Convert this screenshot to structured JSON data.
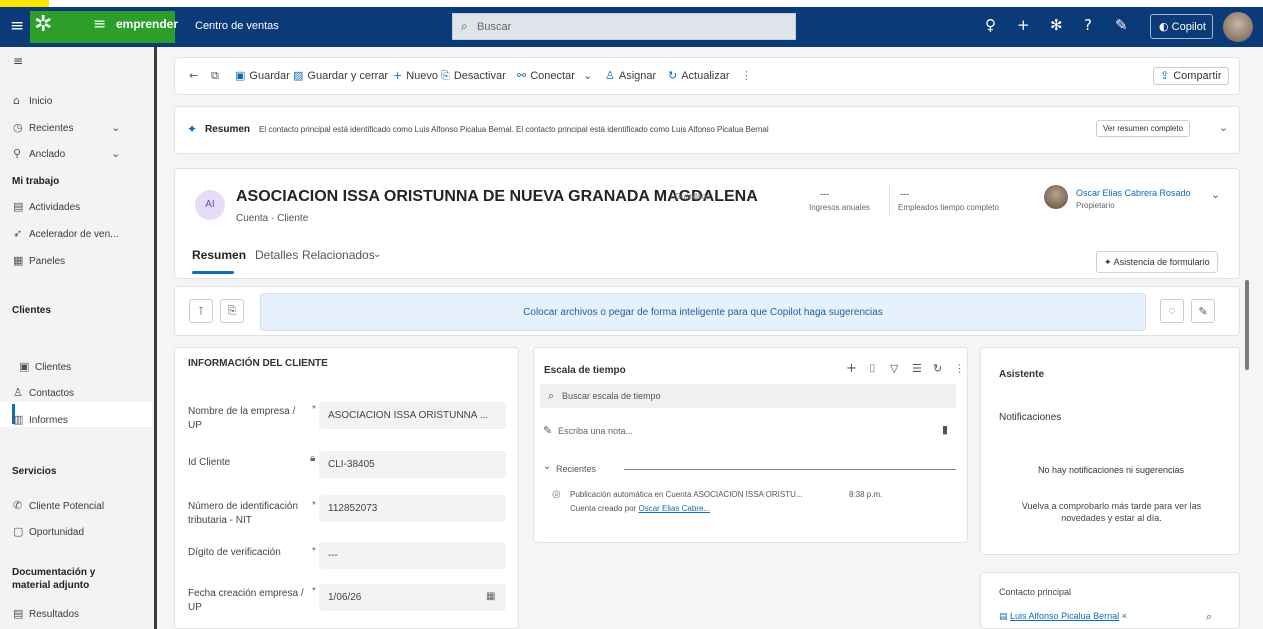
{
  "topbar": {
    "app_name": "Centro de ventas",
    "search_placeholder": "Buscar",
    "logo_word": "emprender",
    "copilot_label": "Copilot"
  },
  "sidebar": {
    "items_top": [
      {
        "label": "Inicio"
      },
      {
        "label": "Recientes"
      },
      {
        "label": "Anclado"
      }
    ],
    "sections": [
      {
        "title": "Mi trabajo",
        "items": [
          "Actividades",
          "Acelerador de ven...",
          "Paneles"
        ]
      },
      {
        "title": "Clientes",
        "items": [
          "Clientes",
          "Contactos",
          "Informes"
        ]
      },
      {
        "title": "Servicios",
        "items": [
          "Cliente Potencial",
          "Oportunidad"
        ]
      },
      {
        "title": "Documentación y material adjunto",
        "items": [
          "Resultados"
        ]
      }
    ]
  },
  "toolbar": {
    "save": "Guardar",
    "save_close": "Guardar y cerrar",
    "new": "Nuevo",
    "deactivate": "Desactivar",
    "connect": "Conectar",
    "assign": "Asignar",
    "refresh": "Actualizar",
    "share": "Compartir"
  },
  "summary": {
    "label": "Resumen",
    "text": "El contacto principal está identificado como Luis Alfonso Picalua Bernal. El contacto principal está identificado como Luis Alfonso Picalua Bernal",
    "view_full": "Ver resumen completo"
  },
  "record": {
    "initials": "AI",
    "name": "ASOCIACION ISSA ORISTUNNA DE NUEVA GRANADA MAGDALENA",
    "saved": "- Guardado",
    "subtitle": "Cuenta · Cliente",
    "stat1_value": "---",
    "stat1_label": "Ingresos anuales",
    "stat2_value": "---",
    "stat2_label": "Empleados tiempo completo",
    "owner_name": "Oscar Elias Cabrera Rosado",
    "owner_role": "Propietario",
    "tabs": [
      "Resumen",
      "Detalles",
      "Relacionados"
    ],
    "form_assist": "Asistencia de formulario"
  },
  "dropzone": {
    "text": "Colocar archivos o pegar de forma inteligente para que Copilot haga sugerencias"
  },
  "client_info": {
    "title": "INFORMACIÓN DEL CLIENTE",
    "fields": [
      {
        "label": "Nombre de la empresa / UP",
        "value": "ASOCIACION ISSA ORISTUNNA ..."
      },
      {
        "label": "Id Cliente",
        "value": "CLI-38405"
      },
      {
        "label": "Número de identificación tributaria - NIT",
        "value": "112852073"
      },
      {
        "label": "Dígito de verificación",
        "value": "---"
      },
      {
        "label": "Fecha creación empresa / UP",
        "value": "1/06/26"
      }
    ]
  },
  "timeline": {
    "title": "Escala de tiempo",
    "search_placeholder": "Buscar escala de tiempo",
    "note_placeholder": "Escriba una nota...",
    "recent_label": "Recientes",
    "entry_line1": "Publicación automática en Cuenta ASOCIACION ISSA ORISTU...",
    "entry_time": "8:38 p.m.",
    "entry_line2_prefix": "Cuenta creado por",
    "entry_author": "Oscar Elias Cabre..."
  },
  "notifications": {
    "assistant_title": "Asistente",
    "notif_title": "Notificaciones",
    "empty_title": "No hay notificaciones ni sugerencias",
    "empty_text": "Vuelva a comprobarlo más tarde para ver las novedades y estar al día."
  },
  "contact": {
    "label": "Contacto principal",
    "value": "Luis Alfonso Picalua Bernal"
  }
}
